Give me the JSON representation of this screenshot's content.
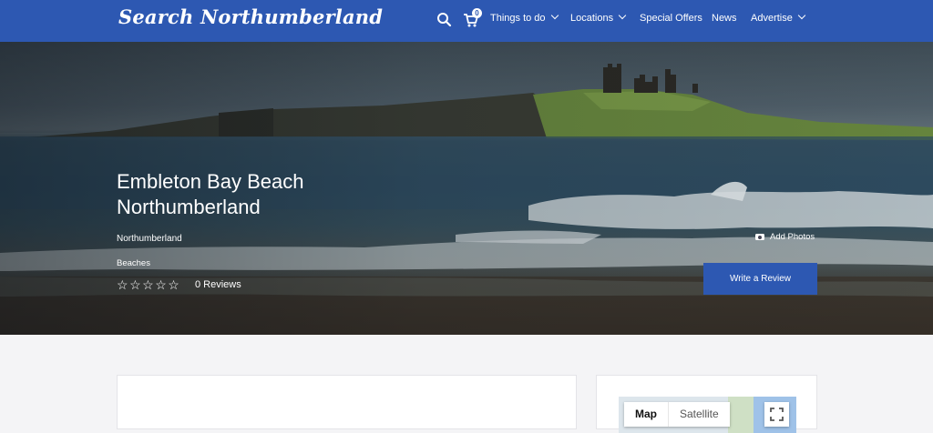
{
  "header": {
    "logo": "Search Northumberland",
    "cart_count": "0",
    "nav": [
      {
        "label": "Things to do",
        "dropdown": true
      },
      {
        "label": "Locations",
        "dropdown": true
      },
      {
        "label": "Special Offers",
        "dropdown": false
      },
      {
        "label": "News",
        "dropdown": false
      },
      {
        "label": "Advertise",
        "dropdown": true
      }
    ],
    "icons": [
      "search-icon",
      "cart-icon"
    ],
    "color": "#2d58b2"
  },
  "listing": {
    "title_line1": "Embleton Bay Beach",
    "title_line2": "Northumberland",
    "location": "Northumberland",
    "category": "Beaches",
    "rating": 0,
    "rating_max": 5,
    "reviews_label": "0 Reviews",
    "add_photos": "Add Photos",
    "write_review": "Write a Review"
  },
  "map": {
    "tab_map": "Map",
    "tab_satellite": "Satellite"
  }
}
